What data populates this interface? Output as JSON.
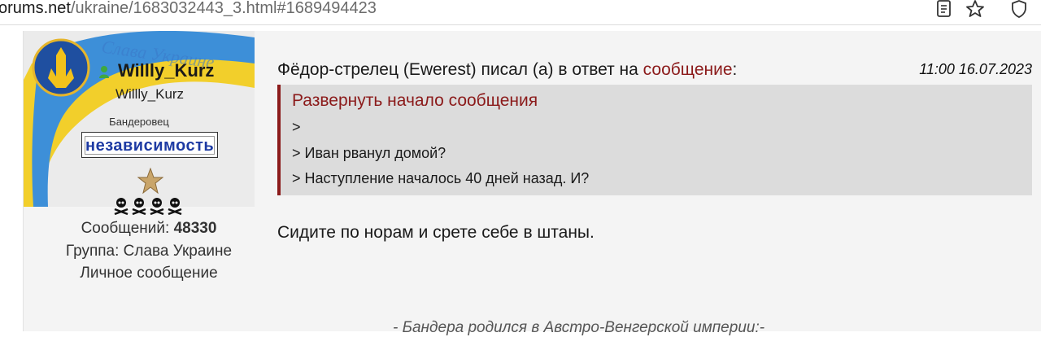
{
  "browser": {
    "url_host": "orums.net",
    "url_path": "/ukraine/1683032443_3.html#1689494423",
    "icons": [
      "reader-view-icon",
      "bookmark-star-icon",
      "shield-icon"
    ]
  },
  "author": {
    "username": "Willly_Kurz",
    "login": "Willly_Kurz",
    "rank": "Бандеровец",
    "badge": "независимость",
    "posts_label": "Сообщений:",
    "posts_count": "48330",
    "group_label": "Группа: Слава Украине",
    "pm_label": "Личное сообщение",
    "status_color": "#3fa83f"
  },
  "post": {
    "author_quote": "Фёдор-стрелец (Ewerest) писал (а) в ответ на ",
    "reply_link": "сообщение",
    "colon": ":",
    "date": "11:00 16.07.2023",
    "quote": {
      "expand_label": "Развернуть начало сообщения",
      "lines": [
        ">",
        "> Иван рванул домой?",
        "> Наступление началось 40 дней назад. И?"
      ]
    },
    "body": "Сидите по норам и срете себе в штаны.",
    "signature": "- Бандера родился в Австро-Венгерской империи:-"
  },
  "colors": {
    "accent": "#8b1a1a",
    "badge_text": "#1d3aa3",
    "quote_bg": "#dcdcdc"
  }
}
